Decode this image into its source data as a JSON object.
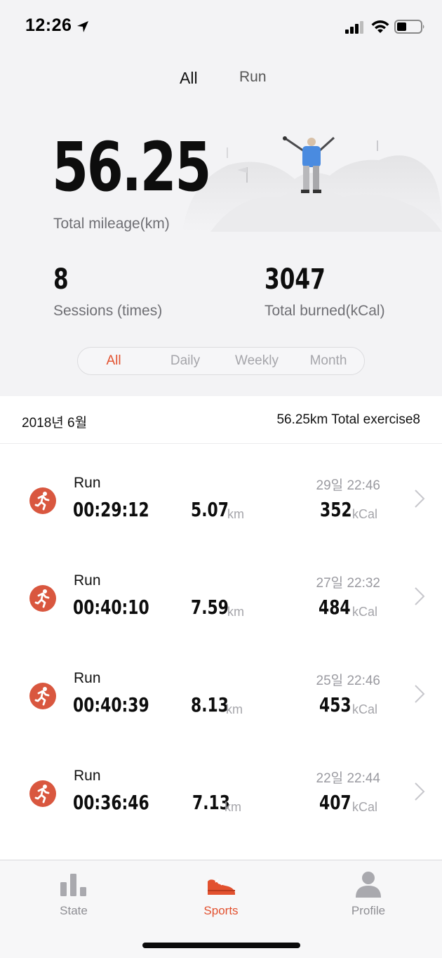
{
  "status_bar": {
    "time": "12:26"
  },
  "top_tabs": [
    {
      "label": "All",
      "active": true
    },
    {
      "label": "Run",
      "active": false
    }
  ],
  "summary": {
    "mileage_value": "56.25",
    "mileage_label": "Total mileage(km)",
    "sessions_value": "8",
    "sessions_label": "Sessions (times)",
    "burned_value": "3047",
    "burned_label": "Total burned(kCal)"
  },
  "period_filter": {
    "options": [
      "All",
      "Daily",
      "Weekly",
      "Month"
    ],
    "selected": "All"
  },
  "month_header": {
    "label": "2018년 6월",
    "summary": "56.25km Total exercise8"
  },
  "activities": [
    {
      "type": "Run",
      "duration": "00:29:12",
      "distance": "5.07",
      "distance_unit": "km",
      "kcal": "352",
      "kcal_unit": "kCal",
      "date": "29일 22:46"
    },
    {
      "type": "Run",
      "duration": "00:40:10",
      "distance": "7.59",
      "distance_unit": "km",
      "kcal": "484",
      "kcal_unit": "kCal",
      "date": "27일 22:32"
    },
    {
      "type": "Run",
      "duration": "00:40:39",
      "distance": "8.13",
      "distance_unit": "km",
      "kcal": "453",
      "kcal_unit": "kCal",
      "date": "25일 22:46"
    },
    {
      "type": "Run",
      "duration": "00:36:46",
      "distance": "7.13",
      "distance_unit": "km",
      "kcal": "407",
      "kcal_unit": "kCal",
      "date": "22일 22:44"
    }
  ],
  "tab_bar": [
    {
      "label": "State",
      "icon": "bar-chart-icon",
      "active": false
    },
    {
      "label": "Sports",
      "icon": "sneaker-icon",
      "active": true
    },
    {
      "label": "Profile",
      "icon": "person-icon",
      "active": false
    }
  ],
  "colors": {
    "accent": "#e2512f",
    "run_icon": "#d9573f",
    "background_top": "#f3f3f5",
    "inactive_text": "#8e8e93"
  }
}
